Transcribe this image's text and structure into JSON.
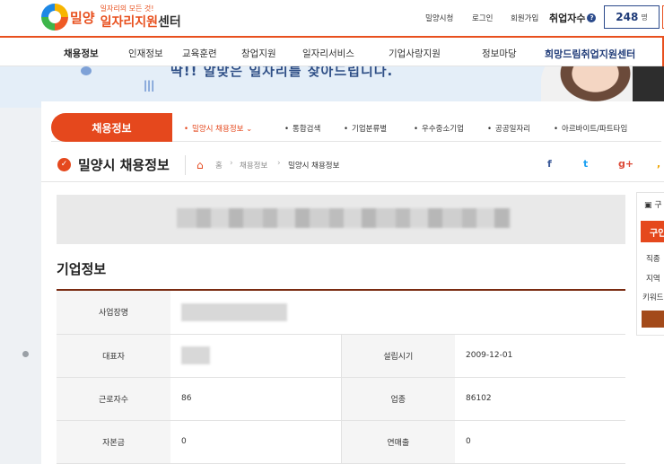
{
  "header": {
    "slogan": "일자리의 모든 것!",
    "city": "밀양",
    "title_main": "일자리지원",
    "title_sub": "센터",
    "util_links": [
      "밀양시청",
      "로그인",
      "회원가입"
    ],
    "employment_label": "취업자수",
    "employment_count": "248",
    "employment_unit": "명"
  },
  "gnb": {
    "items": [
      "채용정보",
      "인재정보",
      "교육훈련",
      "창업지원",
      "일자리서비스",
      "기업사랑지원",
      "정보마당"
    ],
    "brand": "희망드림취업지원센터"
  },
  "banner": {
    "tagline": "딱!! 알맞은 일자리를 찾아드립니다."
  },
  "subnav": {
    "title": "채용정보",
    "items": [
      "밀양시 채용정보",
      "통합검색",
      "기업분류별",
      "우수중소기업",
      "공공일자리",
      "아르바이트/파트타임"
    ]
  },
  "page": {
    "title": "밀양시 채용정보",
    "breadcrumb": [
      "홈",
      "채용정보",
      "밀양시 채용정보"
    ]
  },
  "sns": {
    "facebook": "f",
    "twitter": "t",
    "google": "g+",
    "more": ","
  },
  "company": {
    "section_title": "기업정보",
    "rows": [
      {
        "label": "사업장명",
        "value": ""
      },
      {
        "label": "대표자",
        "value": "",
        "label2": "설립시기",
        "value2": "2009-12-01"
      },
      {
        "label": "근로자수",
        "value": "86",
        "label2": "업종",
        "value2": "86102"
      },
      {
        "label": "자본금",
        "value": "0",
        "label2": "연매출",
        "value2": "0"
      }
    ]
  },
  "sidebar": {
    "head": "구",
    "tab": "구인",
    "labels": [
      "직종",
      "지역",
      "키워드"
    ]
  },
  "colors": {
    "accent": "#e5481d",
    "navy": "#1f3b78",
    "brown": "#7a2b12"
  },
  "icons": [
    "check-circle-icon",
    "home-icon",
    "facebook-icon",
    "twitter-icon",
    "google-plus-icon",
    "question-icon"
  ]
}
